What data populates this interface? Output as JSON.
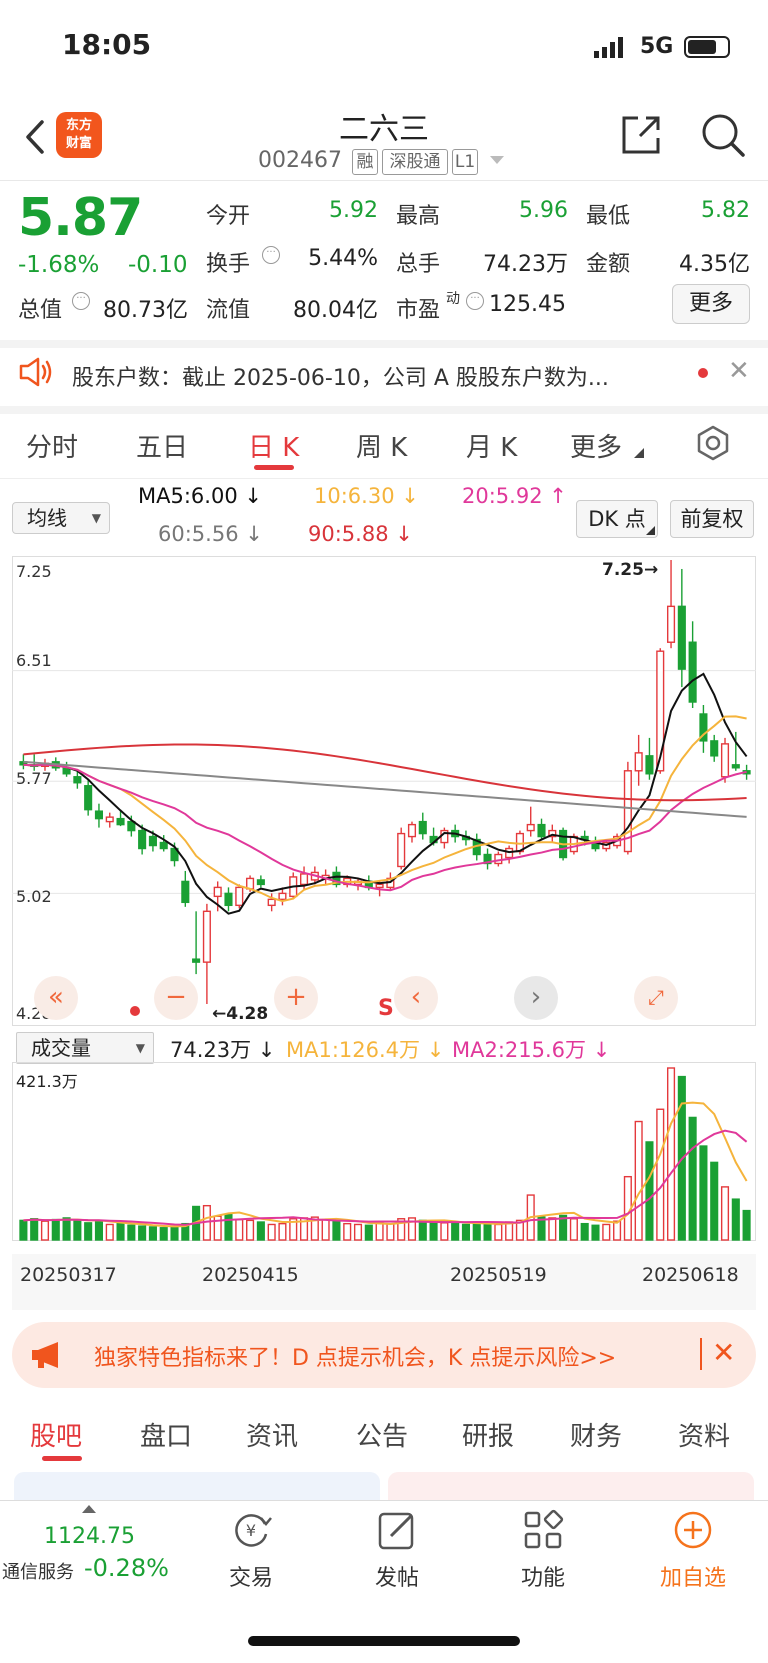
{
  "status": {
    "time": "18:05",
    "network": "5G"
  },
  "header": {
    "logo_line1": "东方",
    "logo_line2": "财富",
    "name": "二六三",
    "code": "002467",
    "tags": [
      "融",
      "深股通",
      "L1"
    ]
  },
  "quote": {
    "price": "5.87",
    "change_pct": "-1.68%",
    "change": "-0.10",
    "open_label": "今开",
    "open": "5.92",
    "high_label": "最高",
    "high": "5.96",
    "low_label": "最低",
    "low": "5.82",
    "turnover_label": "换手",
    "turnover": "5.44%",
    "volume_label": "总手",
    "volume": "74.23万",
    "amount_label": "金额",
    "amount": "4.35亿",
    "mktcap_label": "总值",
    "mktcap": "80.73亿",
    "float_label": "流值",
    "float": "80.04亿",
    "pe_label": "市盈",
    "pe_sup": "动",
    "pe": "125.45",
    "more_label": "更多"
  },
  "notice": {
    "text": "股东户数：截止 2025-06-10，公司 A 股股东户数为..."
  },
  "ktabs": [
    "分时",
    "五日",
    "日 K",
    "周 K",
    "月 K",
    "更多"
  ],
  "ma_row": {
    "selector": "均线",
    "ma5": "MA5:6.00 ↓",
    "ma10": "10:6.30 ↓",
    "ma20": "20:5.92 ↑",
    "ma60": "60:5.56 ↓",
    "ma90": "90:5.88 ↓",
    "dk_label": "DK 点",
    "adjust_label": "前复权"
  },
  "colors": {
    "up": "#e4393c",
    "down": "#1aa034",
    "ma5": "#111111",
    "ma10": "#f5b43c",
    "ma20": "#e0389a",
    "ma60": "#888888",
    "ma90": "#d8343a",
    "accent": "#f0551e"
  },
  "chart_data": [
    {
      "type": "candlestick",
      "y_ticks": [
        "7.25",
        "6.51",
        "5.77",
        "5.02",
        "4.28"
      ],
      "ylim": [
        4.28,
        7.25
      ],
      "max_label": "7.25→",
      "min_label": "←4.28",
      "candles": [
        [
          5.9,
          5.95,
          5.85,
          5.88
        ],
        [
          5.88,
          5.95,
          5.84,
          5.87
        ],
        [
          5.87,
          5.92,
          5.84,
          5.89
        ],
        [
          5.9,
          5.93,
          5.84,
          5.86
        ],
        [
          5.86,
          5.9,
          5.8,
          5.82
        ],
        [
          5.8,
          5.84,
          5.72,
          5.76
        ],
        [
          5.74,
          5.78,
          5.54,
          5.58
        ],
        [
          5.57,
          5.62,
          5.46,
          5.52
        ],
        [
          5.5,
          5.56,
          5.46,
          5.53
        ],
        [
          5.52,
          5.58,
          5.47,
          5.48
        ],
        [
          5.5,
          5.54,
          5.4,
          5.44
        ],
        [
          5.44,
          5.48,
          5.28,
          5.32
        ],
        [
          5.4,
          5.44,
          5.3,
          5.34
        ],
        [
          5.36,
          5.41,
          5.3,
          5.32
        ],
        [
          5.32,
          5.36,
          5.2,
          5.24
        ],
        [
          5.1,
          5.17,
          4.93,
          4.96
        ],
        [
          4.58,
          4.9,
          4.48,
          4.56
        ],
        [
          4.56,
          4.95,
          4.28,
          4.9
        ],
        [
          5.0,
          5.1,
          4.9,
          5.06
        ],
        [
          5.02,
          5.06,
          4.9,
          4.94
        ],
        [
          4.94,
          5.08,
          4.92,
          5.06
        ],
        [
          5.05,
          5.14,
          5.03,
          5.12
        ],
        [
          5.11,
          5.14,
          5.06,
          5.08
        ],
        [
          4.94,
          5.02,
          4.9,
          4.98
        ],
        [
          4.98,
          5.06,
          4.94,
          5.02
        ],
        [
          5.0,
          5.16,
          4.98,
          5.13
        ],
        [
          5.08,
          5.2,
          5.04,
          5.15
        ],
        [
          5.11,
          5.2,
          5.08,
          5.16
        ],
        [
          5.12,
          5.18,
          5.08,
          5.14
        ],
        [
          5.16,
          5.2,
          5.06,
          5.08
        ],
        [
          5.08,
          5.14,
          5.06,
          5.12
        ],
        [
          5.08,
          5.12,
          5.04,
          5.1
        ],
        [
          5.1,
          5.14,
          5.04,
          5.06
        ],
        [
          5.06,
          5.1,
          5.0,
          5.08
        ],
        [
          5.06,
          5.16,
          5.04,
          5.12
        ],
        [
          5.2,
          5.46,
          5.18,
          5.42
        ],
        [
          5.4,
          5.5,
          5.36,
          5.48
        ],
        [
          5.5,
          5.56,
          5.38,
          5.42
        ],
        [
          5.4,
          5.46,
          5.34,
          5.36
        ],
        [
          5.36,
          5.46,
          5.32,
          5.44
        ],
        [
          5.44,
          5.48,
          5.36,
          5.4
        ],
        [
          5.4,
          5.44,
          5.34,
          5.38
        ],
        [
          5.38,
          5.42,
          5.24,
          5.28
        ],
        [
          5.28,
          5.32,
          5.18,
          5.22
        ],
        [
          5.22,
          5.3,
          5.2,
          5.28
        ],
        [
          5.26,
          5.34,
          5.22,
          5.32
        ],
        [
          5.3,
          5.44,
          5.28,
          5.42
        ],
        [
          5.44,
          5.6,
          5.4,
          5.48
        ],
        [
          5.48,
          5.52,
          5.38,
          5.4
        ],
        [
          5.4,
          5.48,
          5.36,
          5.44
        ],
        [
          5.44,
          5.46,
          5.24,
          5.26
        ],
        [
          5.3,
          5.42,
          5.28,
          5.4
        ],
        [
          5.4,
          5.44,
          5.34,
          5.38
        ],
        [
          5.36,
          5.4,
          5.3,
          5.32
        ],
        [
          5.32,
          5.38,
          5.3,
          5.36
        ],
        [
          5.34,
          5.42,
          5.32,
          5.4
        ],
        [
          5.3,
          5.9,
          5.28,
          5.84
        ],
        [
          5.84,
          6.08,
          5.74,
          5.96
        ],
        [
          5.94,
          6.06,
          5.78,
          5.82
        ],
        [
          5.84,
          6.66,
          5.82,
          6.64
        ],
        [
          6.7,
          7.25,
          6.66,
          6.94
        ],
        [
          6.94,
          7.19,
          6.4,
          6.52
        ],
        [
          6.7,
          6.84,
          6.26,
          6.3
        ],
        [
          6.22,
          6.28,
          5.96,
          6.04
        ],
        [
          6.04,
          6.08,
          5.9,
          5.94
        ],
        [
          5.8,
          6.06,
          5.76,
          6.02
        ],
        [
          5.88,
          6.1,
          5.84,
          5.86
        ],
        [
          5.84,
          5.88,
          5.78,
          5.82
        ]
      ]
    },
    {
      "type": "bar",
      "title": "成交量",
      "latest": "74.23万 ↓",
      "ma1": "MA1:126.4万 ↓",
      "ma2": "MA2:215.6万 ↓",
      "max_label": "421.3万",
      "x_labels": [
        "20250317",
        "20250415",
        "20250519",
        "20250618"
      ],
      "values": [
        48,
        52,
        46,
        50,
        54,
        48,
        42,
        46,
        38,
        40,
        36,
        34,
        32,
        30,
        34,
        40,
        82,
        84,
        58,
        62,
        50,
        48,
        44,
        38,
        40,
        52,
        54,
        56,
        50,
        46,
        40,
        38,
        36,
        42,
        40,
        52,
        54,
        48,
        44,
        42,
        40,
        38,
        42,
        40,
        38,
        44,
        48,
        110,
        56,
        54,
        60,
        52,
        40,
        36,
        38,
        46,
        155,
        290,
        240,
        320,
        421,
        400,
        300,
        230,
        190,
        130,
        100,
        72
      ]
    }
  ],
  "vol_selector": "成交量",
  "banner": {
    "text": "独家特色指标来了！D 点提示机会，K 点提示风险>>"
  },
  "btabs": [
    "股吧",
    "盘口",
    "资讯",
    "公告",
    "研报",
    "财务",
    "资料"
  ],
  "bottom_nav": {
    "index_value": "1124.75",
    "index_name": "通信服务",
    "index_pct": "-0.28%",
    "items": [
      "交易",
      "发帖",
      "功能",
      "加自选"
    ]
  }
}
